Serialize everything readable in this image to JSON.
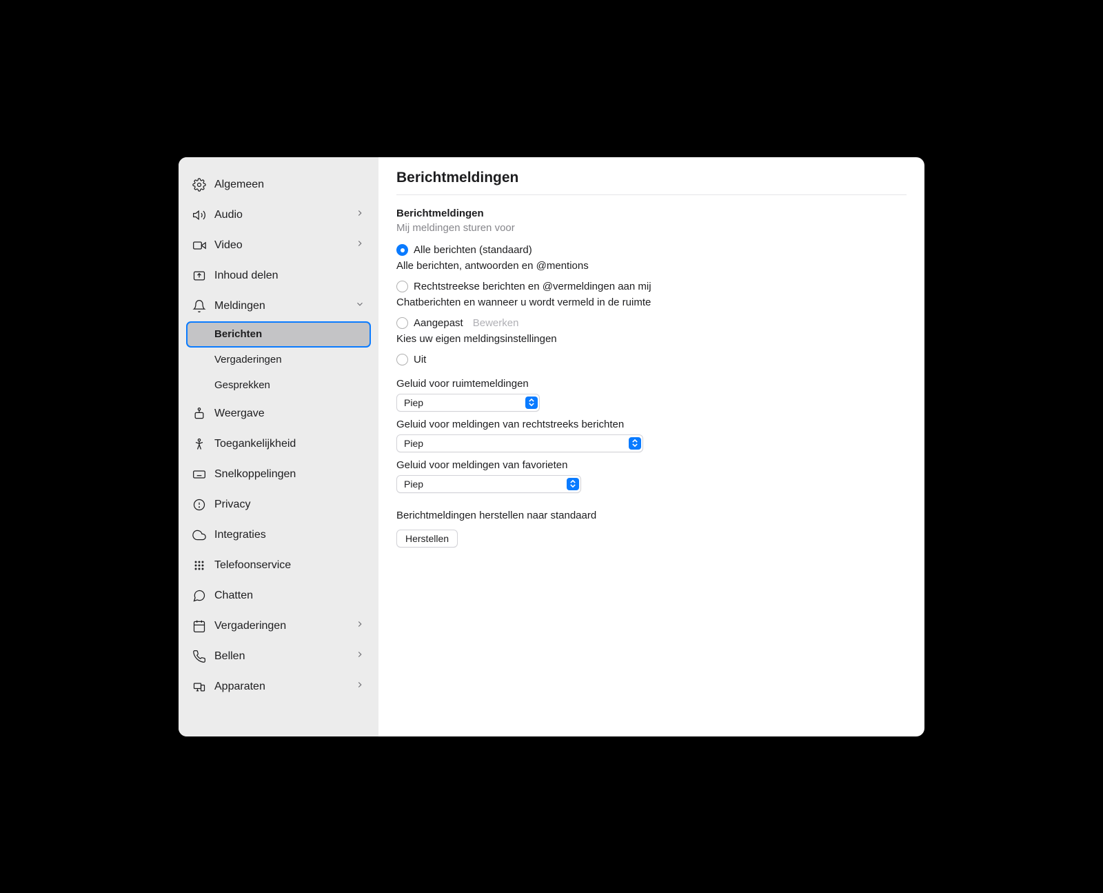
{
  "sidebar": {
    "items": [
      {
        "label": "Algemeen"
      },
      {
        "label": "Audio"
      },
      {
        "label": "Video"
      },
      {
        "label": "Inhoud delen"
      },
      {
        "label": "Meldingen"
      },
      {
        "label": "Weergave"
      },
      {
        "label": "Toegankelijkheid"
      },
      {
        "label": "Snelkoppelingen"
      },
      {
        "label": "Privacy"
      },
      {
        "label": "Integraties"
      },
      {
        "label": "Telefoonservice"
      },
      {
        "label": "Chatten"
      },
      {
        "label": "Vergaderingen"
      },
      {
        "label": "Bellen"
      },
      {
        "label": "Apparaten"
      }
    ],
    "subitems": [
      {
        "label": "Berichten"
      },
      {
        "label": "Vergaderingen"
      },
      {
        "label": "Gesprekken"
      }
    ]
  },
  "page": {
    "title": "Berichtmeldingen",
    "section_heading": "Berichtmeldingen",
    "section_subheading": "Mij meldingen sturen voor",
    "radios": {
      "all": {
        "label": "Alle berichten (standaard)",
        "desc": "Alle berichten, antwoorden en @mentions"
      },
      "direct": {
        "label": "Rechtstreekse berichten en @vermeldingen aan mij",
        "desc": "Chatberichten en wanneer u wordt vermeld in de ruimte"
      },
      "custom": {
        "label": "Aangepast",
        "edit": "Bewerken",
        "desc": "Kies uw eigen meldingsinstellingen"
      },
      "off": {
        "label": "Uit"
      }
    },
    "sounds": {
      "room": {
        "label": "Geluid voor ruimtemeldingen",
        "value": "Piep"
      },
      "direct": {
        "label": "Geluid voor meldingen van rechtstreeks berichten",
        "value": "Piep"
      },
      "favorites": {
        "label": "Geluid voor meldingen van favorieten",
        "value": "Piep"
      }
    },
    "reset": {
      "heading": "Berichtmeldingen herstellen naar standaard",
      "button": "Herstellen"
    }
  }
}
